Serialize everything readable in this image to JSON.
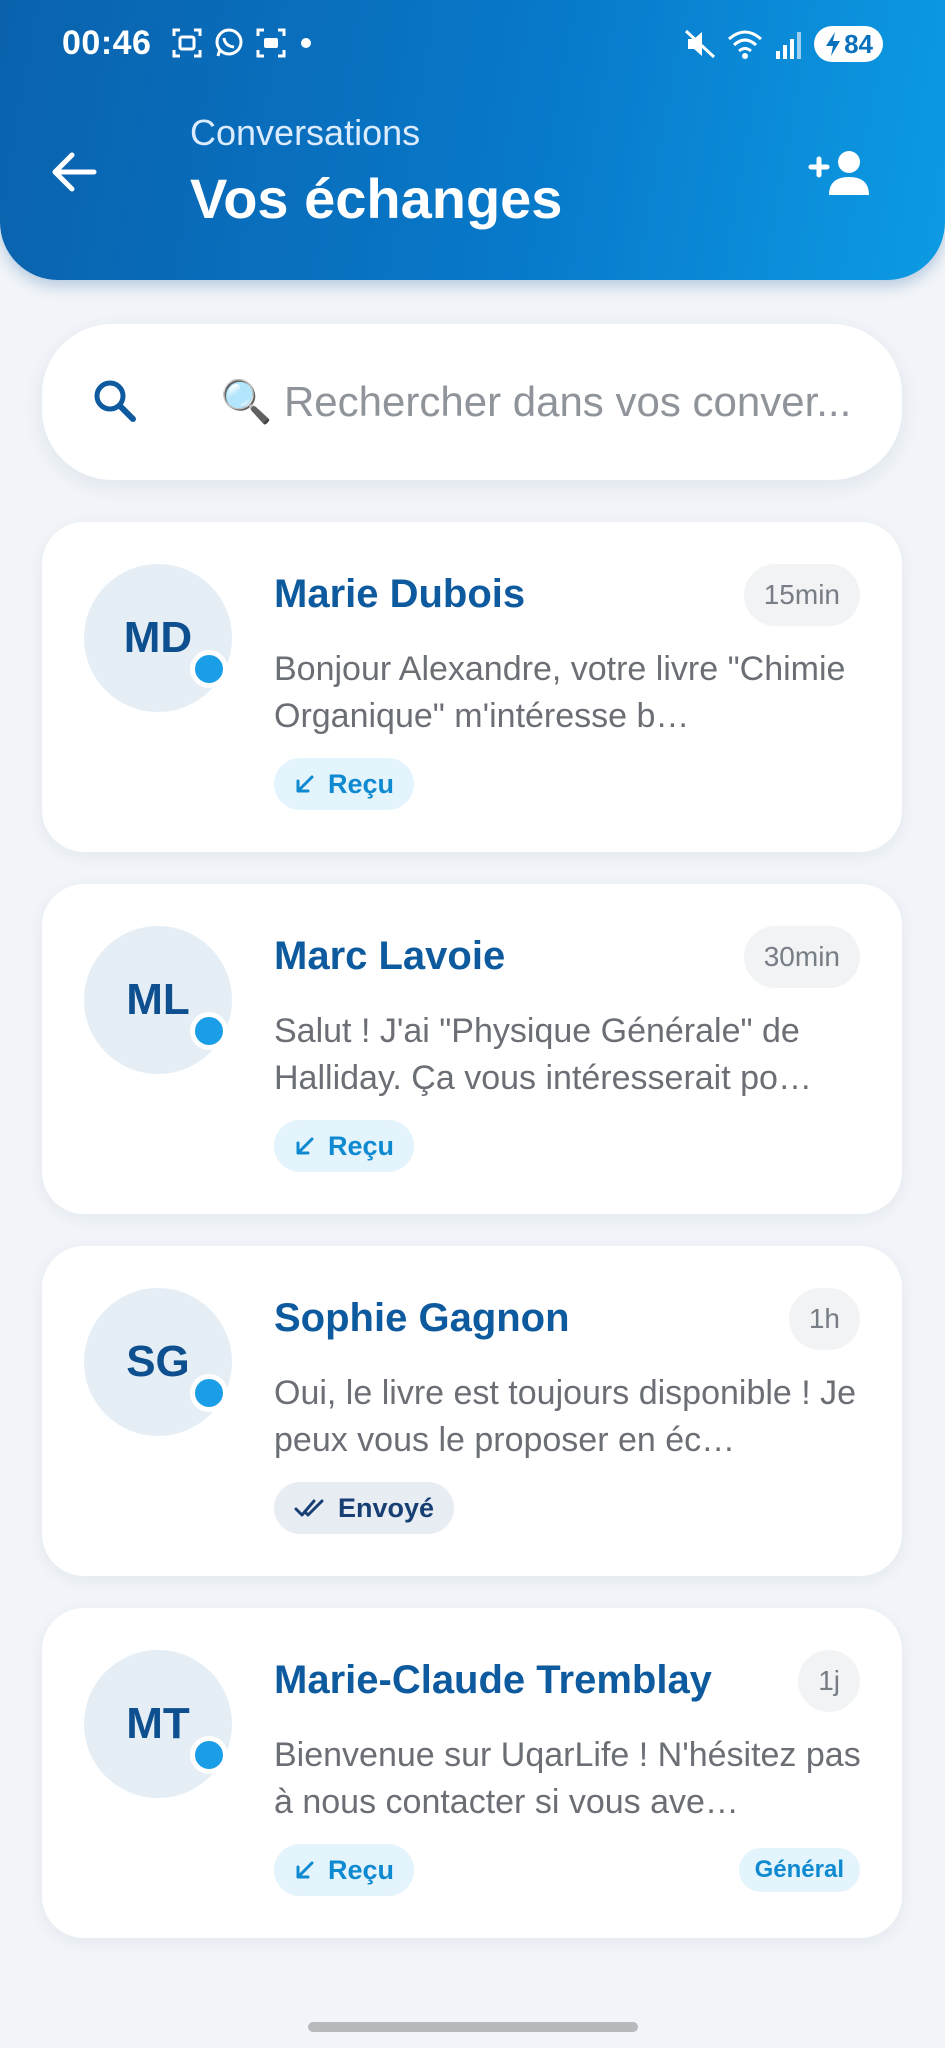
{
  "status_bar": {
    "time": "00:46",
    "battery": "84",
    "left_icons": [
      "screenshot-icon",
      "whatsapp-icon",
      "screen-record-icon",
      "dot-icon"
    ],
    "right_icons": [
      "mute-icon",
      "wifi-icon",
      "signal-icon",
      "battery-icon"
    ]
  },
  "header": {
    "subtitle": "Conversations",
    "title": "Vos échanges"
  },
  "search": {
    "placeholder": "🔍 Rechercher dans vos conver..."
  },
  "conversations": [
    {
      "initials": "MD",
      "name": "Marie Dubois",
      "time": "15min",
      "preview": "Bonjour Alexandre, votre livre \"Chimie Organique\" m'intéresse b…",
      "status": "Reçu",
      "status_type": "received",
      "tag": ""
    },
    {
      "initials": "ML",
      "name": "Marc Lavoie",
      "time": "30min",
      "preview": "Salut ! J'ai \"Physique Générale\" de Halliday. Ça vous intéresserait po…",
      "status": "Reçu",
      "status_type": "received",
      "tag": ""
    },
    {
      "initials": "SG",
      "name": "Sophie Gagnon",
      "time": "1h",
      "preview": "Oui, le livre est toujours disponible ! Je peux vous le proposer en éc…",
      "status": "Envoyé",
      "status_type": "sent",
      "tag": ""
    },
    {
      "initials": "MT",
      "name": "Marie-Claude Tremblay",
      "time": "1j",
      "preview": "Bienvenue sur UqarLife ! N'hésitez pas à nous contacter si vous ave…",
      "status": "Reçu",
      "status_type": "received",
      "tag": "Général"
    }
  ],
  "colors": {
    "header_gradient_start": "#0a62ad",
    "header_gradient_end": "#0d9be3",
    "accent": "#1a9ee8",
    "name_color": "#0e5a9e",
    "background": "#f1f4f8"
  }
}
